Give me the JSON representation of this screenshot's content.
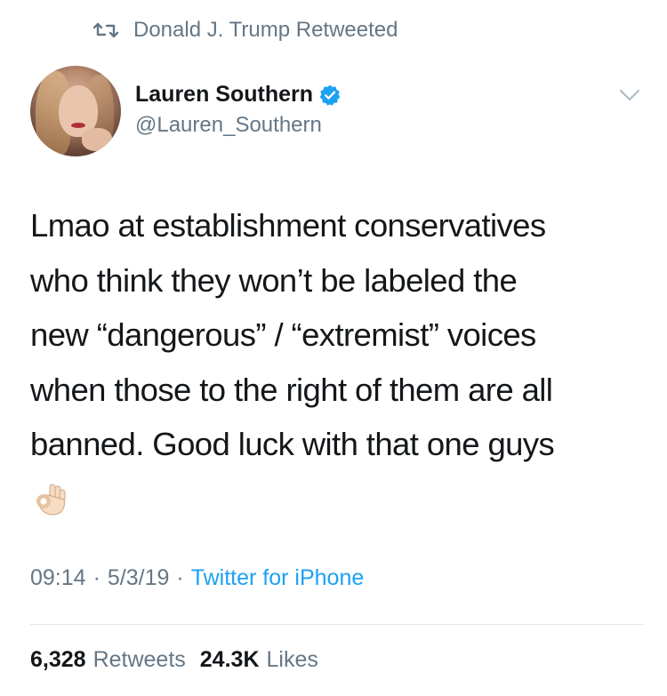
{
  "retweet": {
    "icon": "retweet-icon",
    "text": "Donald J. Trump Retweeted"
  },
  "author": {
    "avatar": "profile-photo",
    "name": "Lauren Southern",
    "handle": "@Lauren_Southern",
    "verified_icon": "verified-badge-icon",
    "verified_color": "#1da1f2"
  },
  "menu": {
    "icon": "chevron-down-icon"
  },
  "tweet": {
    "text": "Lmao at establishment conservatives\nwho think they won’t be labeled the\nnew “dangerous” / “extremist” voices\nwhen those to the right of them are all\nbanned. Good luck with that one guys",
    "emoji": "👌🏻"
  },
  "meta": {
    "time": "09:14",
    "date": "5/3/19",
    "source": "Twitter for iPhone",
    "separator": "·"
  },
  "stats": {
    "retweets_count": "6,328",
    "retweets_label": "Retweets",
    "likes_count": "24.3K",
    "likes_label": "Likes"
  },
  "colors": {
    "text_primary": "#14171a",
    "text_secondary": "#657786",
    "link": "#1da1f2",
    "divider": "#e1e8ed"
  }
}
